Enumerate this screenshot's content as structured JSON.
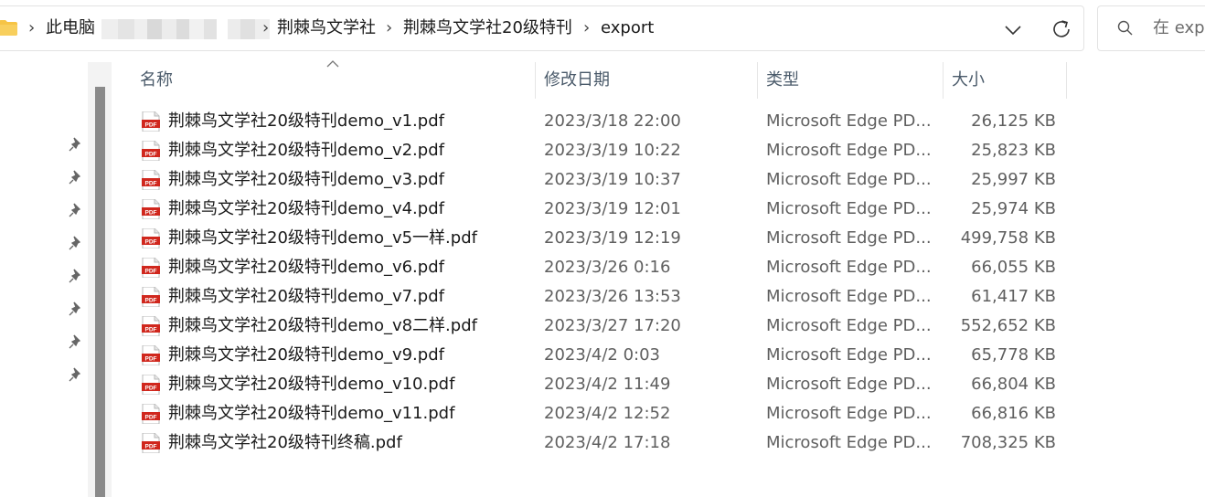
{
  "address_bar": {
    "crumbs": [
      "此电脑",
      "荆棘鸟文学社",
      "荆棘鸟文学社20级特刊",
      "export"
    ],
    "separator": "›"
  },
  "search": {
    "placeholder": "在 expo"
  },
  "columns": {
    "name": "名称",
    "date": "修改日期",
    "type": "类型",
    "size": "大小"
  },
  "files": [
    {
      "name": "荆棘鸟文学社20级特刊demo_v1.pdf",
      "date": "2023/3/18 22:00",
      "type": "Microsoft Edge PD...",
      "size": "26,125 KB"
    },
    {
      "name": "荆棘鸟文学社20级特刊demo_v2.pdf",
      "date": "2023/3/19 10:22",
      "type": "Microsoft Edge PD...",
      "size": "25,823 KB"
    },
    {
      "name": "荆棘鸟文学社20级特刊demo_v3.pdf",
      "date": "2023/3/19 10:37",
      "type": "Microsoft Edge PD...",
      "size": "25,997 KB"
    },
    {
      "name": "荆棘鸟文学社20级特刊demo_v4.pdf",
      "date": "2023/3/19 12:01",
      "type": "Microsoft Edge PD...",
      "size": "25,974 KB"
    },
    {
      "name": "荆棘鸟文学社20级特刊demo_v5一样.pdf",
      "date": "2023/3/19 12:19",
      "type": "Microsoft Edge PD...",
      "size": "499,758 KB"
    },
    {
      "name": "荆棘鸟文学社20级特刊demo_v6.pdf",
      "date": "2023/3/26 0:16",
      "type": "Microsoft Edge PD...",
      "size": "66,055 KB"
    },
    {
      "name": "荆棘鸟文学社20级特刊demo_v7.pdf",
      "date": "2023/3/26 13:53",
      "type": "Microsoft Edge PD...",
      "size": "61,417 KB"
    },
    {
      "name": "荆棘鸟文学社20级特刊demo_v8二样.pdf",
      "date": "2023/3/27 17:20",
      "type": "Microsoft Edge PD...",
      "size": "552,652 KB"
    },
    {
      "name": "荆棘鸟文学社20级特刊demo_v9.pdf",
      "date": "2023/4/2 0:03",
      "type": "Microsoft Edge PD...",
      "size": "65,778 KB"
    },
    {
      "name": "荆棘鸟文学社20级特刊demo_v10.pdf",
      "date": "2023/4/2 11:49",
      "type": "Microsoft Edge PD...",
      "size": "66,804 KB"
    },
    {
      "name": "荆棘鸟文学社20级特刊demo_v11.pdf",
      "date": "2023/4/2 12:52",
      "type": "Microsoft Edge PD...",
      "size": "66,816 KB"
    },
    {
      "name": "荆棘鸟文学社20级特刊终稿.pdf",
      "date": "2023/4/2 17:18",
      "type": "Microsoft Edge PD...",
      "size": "708,325 KB"
    }
  ],
  "icons": {
    "folder": "folder-icon",
    "chevron": "chevron-down-icon",
    "refresh": "refresh-icon",
    "search": "search-icon",
    "pin": "pin-icon",
    "pdf": "pdf-file-icon",
    "sort": "sort-ascending-icon"
  },
  "colors": {
    "pdf_red": "#d0271d",
    "header_text": "#4a5a6a",
    "folder_yellow": "#f6c445"
  }
}
